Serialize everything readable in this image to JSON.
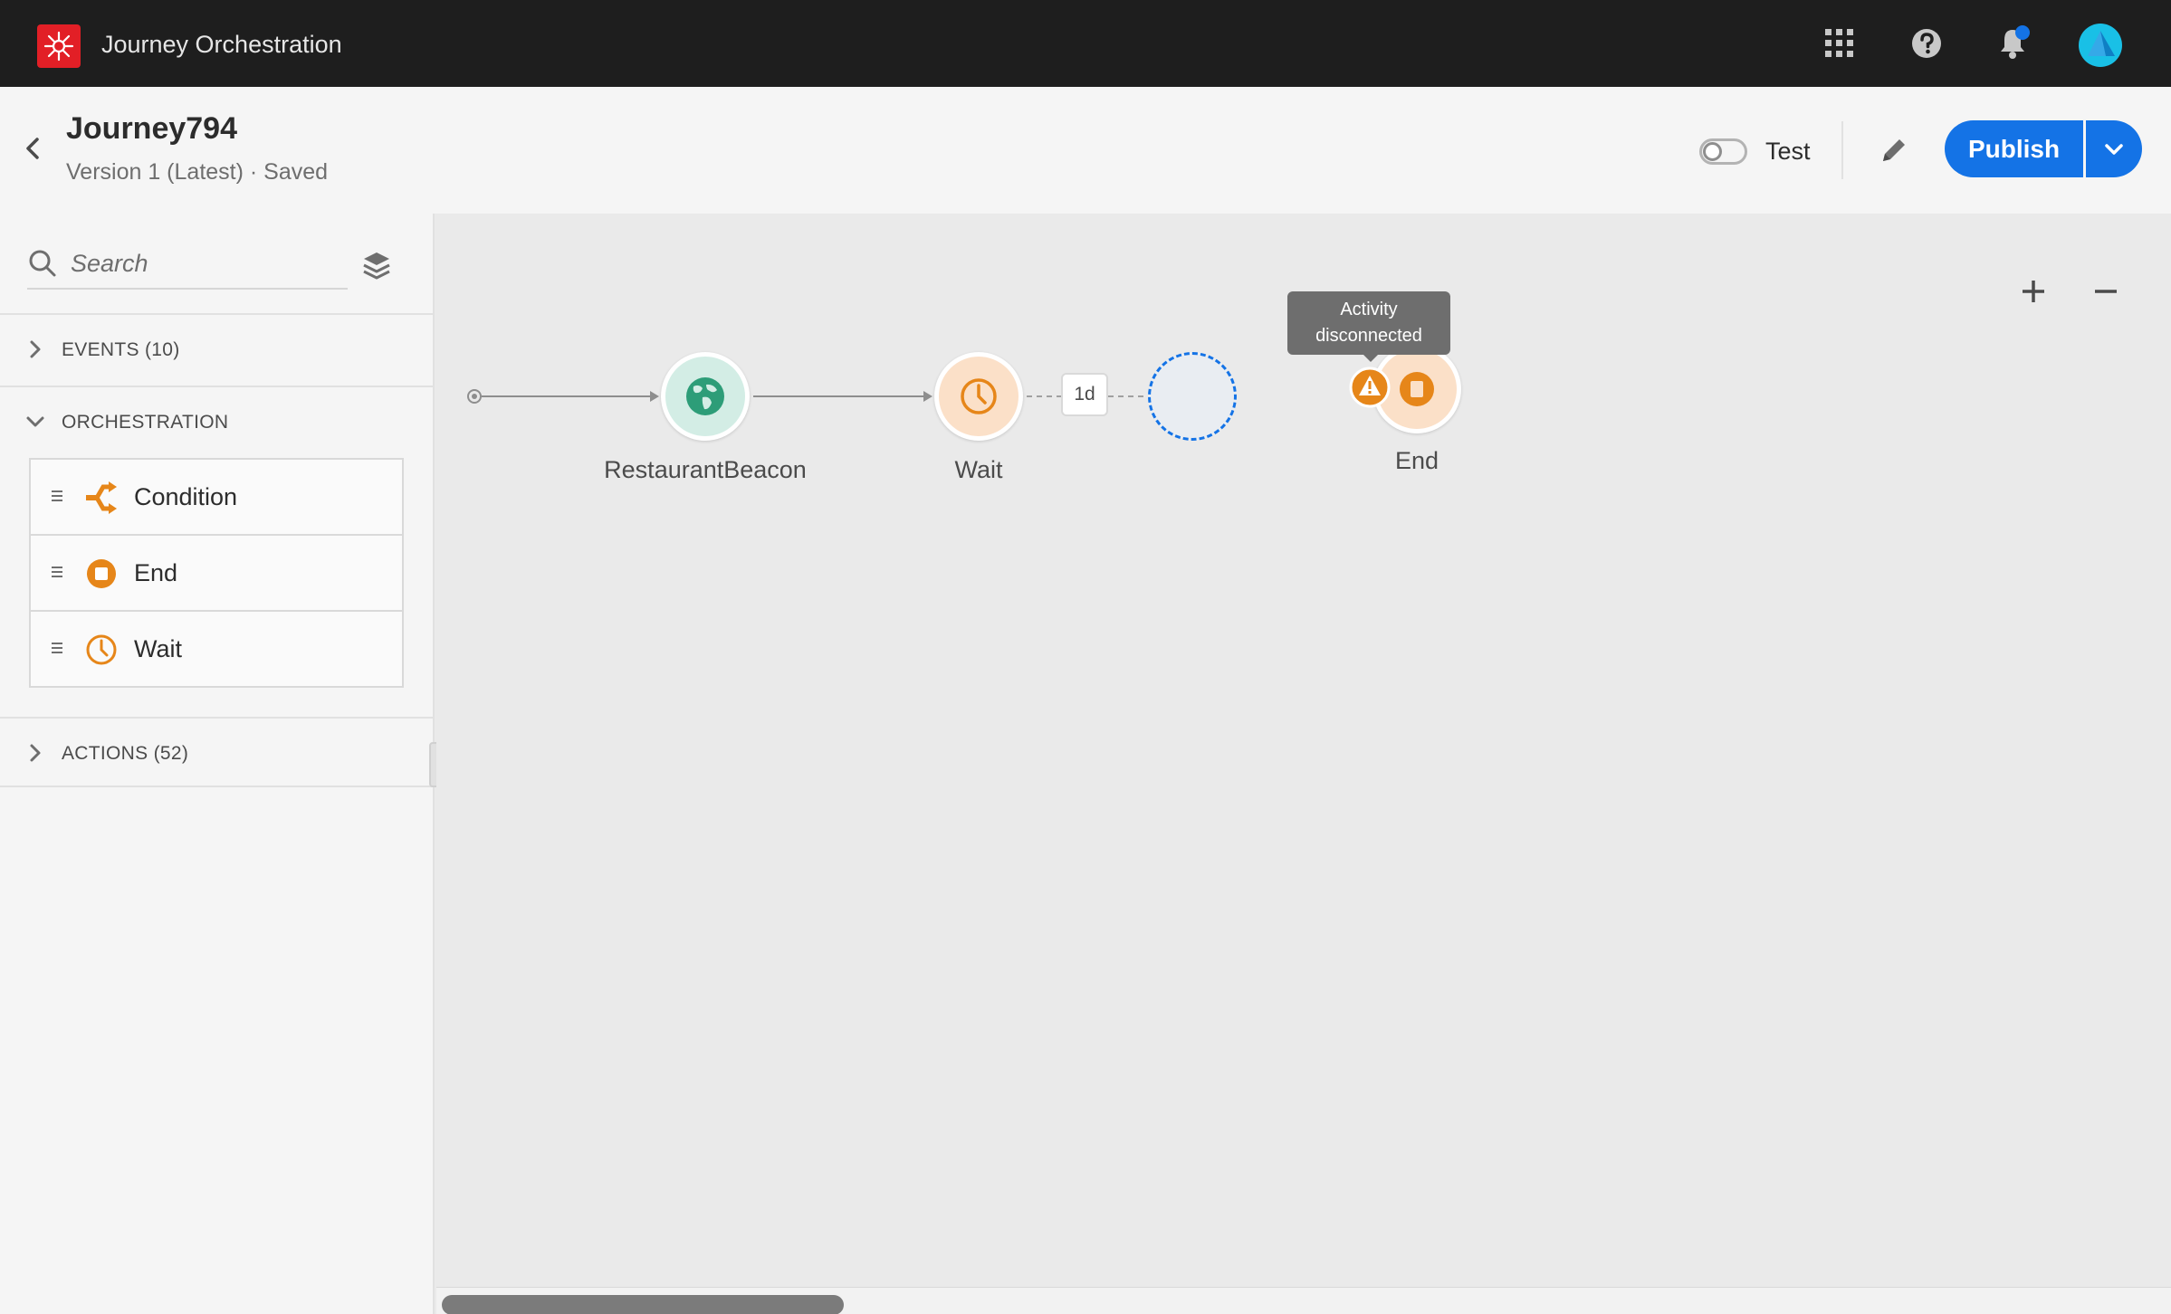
{
  "app": {
    "title": "Journey Orchestration"
  },
  "header": {
    "journey_name": "Journey794",
    "version_status": "Version 1 (Latest) · Saved",
    "test_label": "Test",
    "test_enabled": false,
    "publish_label": "Publish"
  },
  "sidebar": {
    "search_placeholder": "Search",
    "sections": {
      "events": {
        "label": "EVENTS (10)",
        "expanded": false
      },
      "orchestration": {
        "label": "ORCHESTRATION",
        "expanded": true,
        "items": [
          {
            "label": "Condition",
            "icon": "condition-icon"
          },
          {
            "label": "End",
            "icon": "end-icon"
          },
          {
            "label": "Wait",
            "icon": "clock-icon"
          }
        ]
      },
      "actions": {
        "label": "ACTIONS (52)",
        "expanded": false
      }
    }
  },
  "canvas": {
    "nodes": {
      "beacon": {
        "label": "RestaurantBeacon",
        "icon": "globe-icon"
      },
      "wait": {
        "label": "Wait",
        "icon": "clock-icon"
      },
      "wait_duration": "1d",
      "end": {
        "label": "End",
        "icon": "end-icon"
      }
    },
    "tooltip": {
      "line1": "Activity",
      "line2": "disconnected"
    }
  },
  "colors": {
    "topbar": "#1e1e1e",
    "accent": "#1473e6",
    "brand": "#e21f26",
    "orange": "#e68619",
    "event_green": "#2d9d78"
  }
}
